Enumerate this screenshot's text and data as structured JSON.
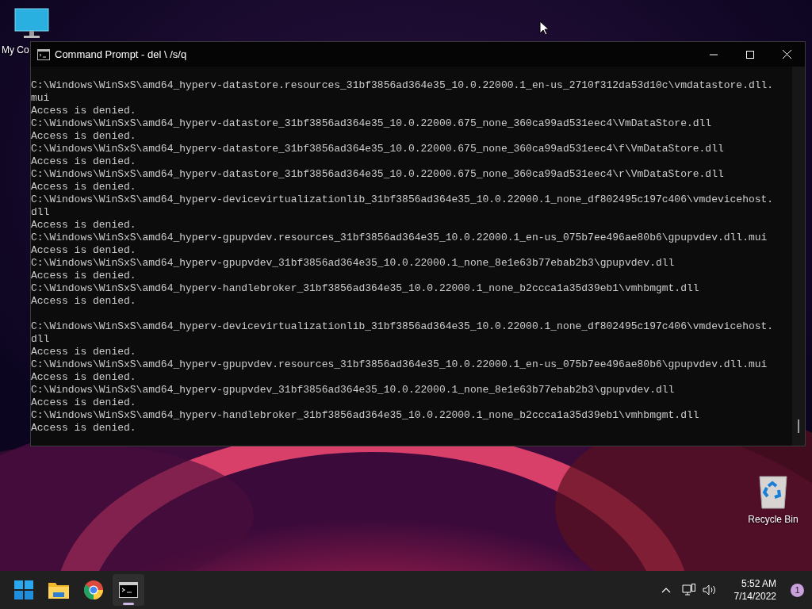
{
  "desktop_icons": [
    {
      "kind": "computer",
      "label": "My Co"
    },
    {
      "kind": "recycle-bin",
      "label": "Recycle Bin"
    }
  ],
  "window": {
    "title": "Command Prompt - del \\ /s/q",
    "lines": [
      {
        "kind": "text",
        "text": "C:\\Windows\\WinSxS\\amd64_hyperv-datastore.resources_31bf3856ad364e35_10.0.22000.1_en-us_2710f312da53d10c\\vmdatastore.dll."
      },
      {
        "kind": "text",
        "text": "mui"
      },
      {
        "kind": "text",
        "text": "Access is denied."
      },
      {
        "kind": "text",
        "text": "C:\\Windows\\WinSxS\\amd64_hyperv-datastore_31bf3856ad364e35_10.0.22000.675_none_360ca99ad531eec4\\VmDataStore.dll"
      },
      {
        "kind": "text",
        "text": "Access is denied."
      },
      {
        "kind": "text",
        "text": "C:\\Windows\\WinSxS\\amd64_hyperv-datastore_31bf3856ad364e35_10.0.22000.675_none_360ca99ad531eec4\\f\\VmDataStore.dll"
      },
      {
        "kind": "text",
        "text": "Access is denied."
      },
      {
        "kind": "text",
        "text": "C:\\Windows\\WinSxS\\amd64_hyperv-datastore_31bf3856ad364e35_10.0.22000.675_none_360ca99ad531eec4\\r\\VmDataStore.dll"
      },
      {
        "kind": "text",
        "text": "Access is denied."
      },
      {
        "kind": "text",
        "text": "C:\\Windows\\WinSxS\\amd64_hyperv-devicevirtualizationlib_31bf3856ad364e35_10.0.22000.1_none_df802495c197c406\\vmdevicehost."
      },
      {
        "kind": "text",
        "text": "dll"
      },
      {
        "kind": "text",
        "text": "Access is denied."
      },
      {
        "kind": "text",
        "text": "C:\\Windows\\WinSxS\\amd64_hyperv-gpupvdev.resources_31bf3856ad364e35_10.0.22000.1_en-us_075b7ee496ae80b6\\gpupvdev.dll.mui"
      },
      {
        "kind": "text",
        "text": "Access is denied."
      },
      {
        "kind": "text",
        "text": "C:\\Windows\\WinSxS\\amd64_hyperv-gpupvdev_31bf3856ad364e35_10.0.22000.1_none_8e1e63b77ebab2b3\\gpupvdev.dll"
      },
      {
        "kind": "text",
        "text": "Access is denied."
      },
      {
        "kind": "text",
        "text": "C:\\Windows\\WinSxS\\amd64_hyperv-handlebroker_31bf3856ad364e35_10.0.22000.1_none_b2ccca1a35d39eb1\\vmhbmgmt.dll"
      },
      {
        "kind": "text",
        "text": "Access is denied."
      },
      {
        "kind": "blank"
      },
      {
        "kind": "text",
        "text": "C:\\Windows\\WinSxS\\amd64_hyperv-devicevirtualizationlib_31bf3856ad364e35_10.0.22000.1_none_df802495c197c406\\vmdevicehost."
      },
      {
        "kind": "text",
        "text": "dll"
      },
      {
        "kind": "text",
        "text": "Access is denied."
      },
      {
        "kind": "text",
        "text": "C:\\Windows\\WinSxS\\amd64_hyperv-gpupvdev.resources_31bf3856ad364e35_10.0.22000.1_en-us_075b7ee496ae80b6\\gpupvdev.dll.mui"
      },
      {
        "kind": "text",
        "text": "Access is denied."
      },
      {
        "kind": "text",
        "text": "C:\\Windows\\WinSxS\\amd64_hyperv-gpupvdev_31bf3856ad364e35_10.0.22000.1_none_8e1e63b77ebab2b3\\gpupvdev.dll"
      },
      {
        "kind": "text",
        "text": "Access is denied."
      },
      {
        "kind": "text",
        "text": "C:\\Windows\\WinSxS\\amd64_hyperv-handlebroker_31bf3856ad364e35_10.0.22000.1_none_b2ccca1a35d39eb1\\vmhbmgmt.dll"
      },
      {
        "kind": "text",
        "text": "Access is denied."
      }
    ]
  },
  "taskbar": {
    "apps": [
      {
        "kind": "start",
        "selected": false
      },
      {
        "kind": "explorer",
        "selected": false
      },
      {
        "kind": "chrome",
        "selected": false
      },
      {
        "kind": "terminal",
        "selected": true
      }
    ],
    "time": "5:52 AM",
    "date": "7/14/2022",
    "notification_count": "1"
  }
}
